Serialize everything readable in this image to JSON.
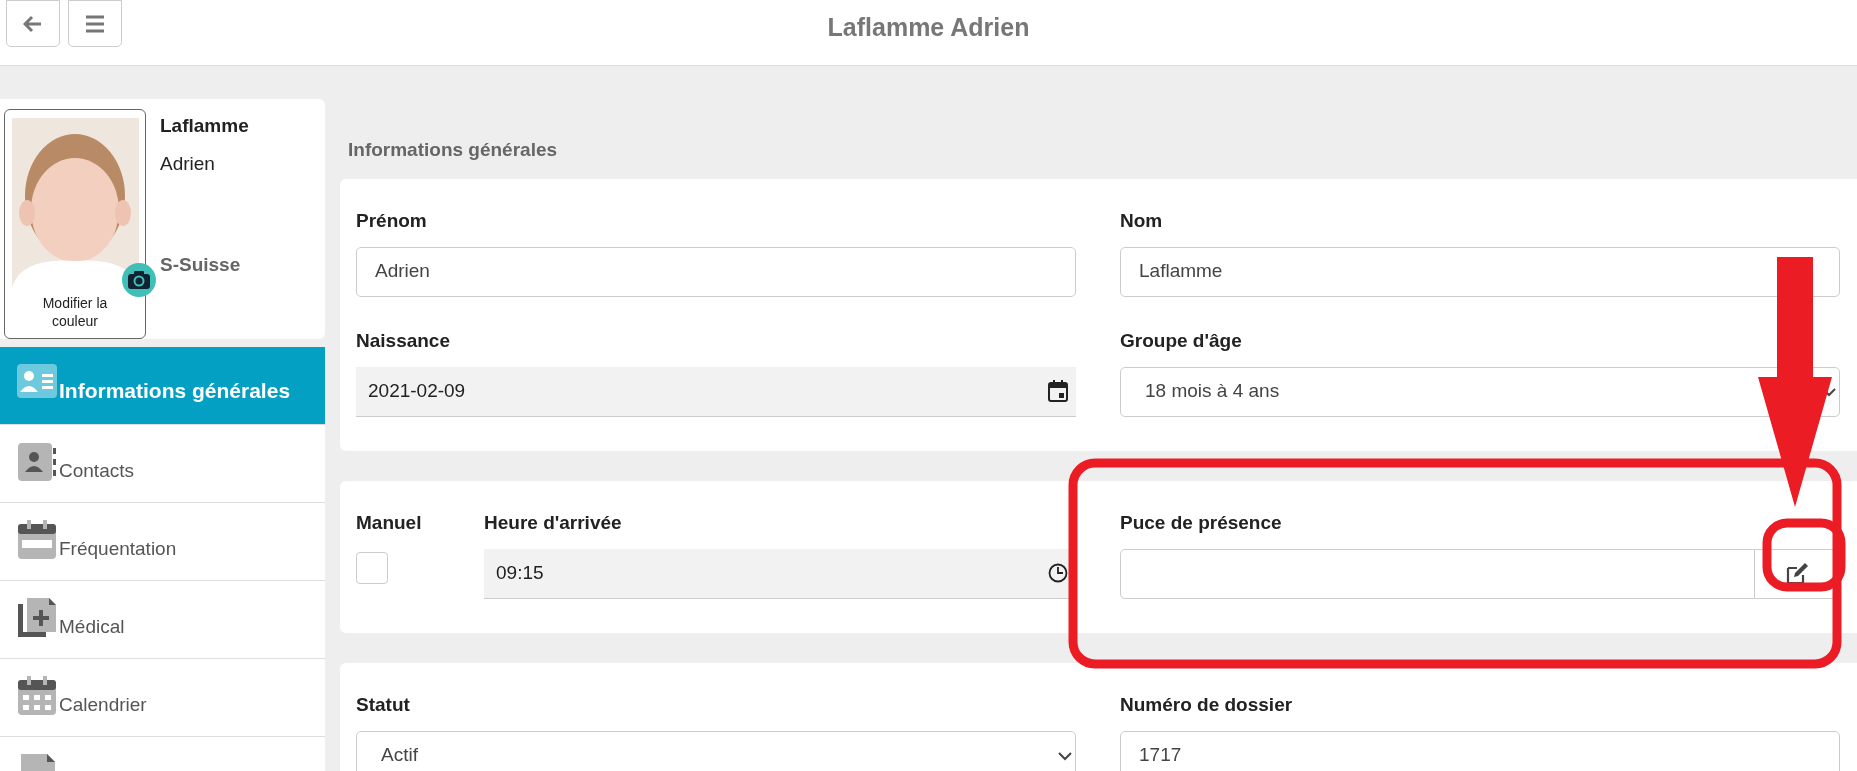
{
  "header": {
    "title": "Laflamme Adrien"
  },
  "profile": {
    "last_name": "Laflamme",
    "first_name": "Adrien",
    "group": "S-Suisse",
    "photo_caption": "Modifier la couleur"
  },
  "nav": [
    {
      "label": "Informations générales",
      "selected": true
    },
    {
      "label": "Contacts",
      "selected": false
    },
    {
      "label": "Fréquentation",
      "selected": false
    },
    {
      "label": "Médical",
      "selected": false
    },
    {
      "label": "Calendrier",
      "selected": false
    },
    {
      "selected": false
    }
  ],
  "section_title": "Informations générales",
  "cards": [
    {
      "rows": [
        [
          [
            {
              "label": "Prénom",
              "kind": "text",
              "value": "Adrien"
            }
          ],
          [
            {
              "label": "Nom",
              "kind": "text",
              "value": "Laflamme"
            }
          ]
        ],
        [
          [
            {
              "label": "Naissance",
              "kind": "date",
              "value": "2021-02-09"
            }
          ],
          [
            {
              "label": "Groupe d'âge",
              "kind": "select",
              "value": "18 mois à 4 ans"
            }
          ]
        ]
      ]
    },
    {
      "rows": [
        [
          [
            {
              "label": "Manuel",
              "kind": "checkbox",
              "checked": false
            },
            {
              "label": "Heure d'arrivée",
              "kind": "time",
              "value": "09:15"
            }
          ],
          [
            {
              "label": "Puce de présence",
              "kind": "edit"
            }
          ]
        ]
      ]
    },
    {
      "rows": [
        [
          [
            {
              "label": "Statut",
              "kind": "select",
              "value": "Actif"
            }
          ],
          [
            {
              "label": "Numéro de dossier",
              "kind": "text",
              "value": "1717"
            }
          ]
        ]
      ]
    }
  ]
}
